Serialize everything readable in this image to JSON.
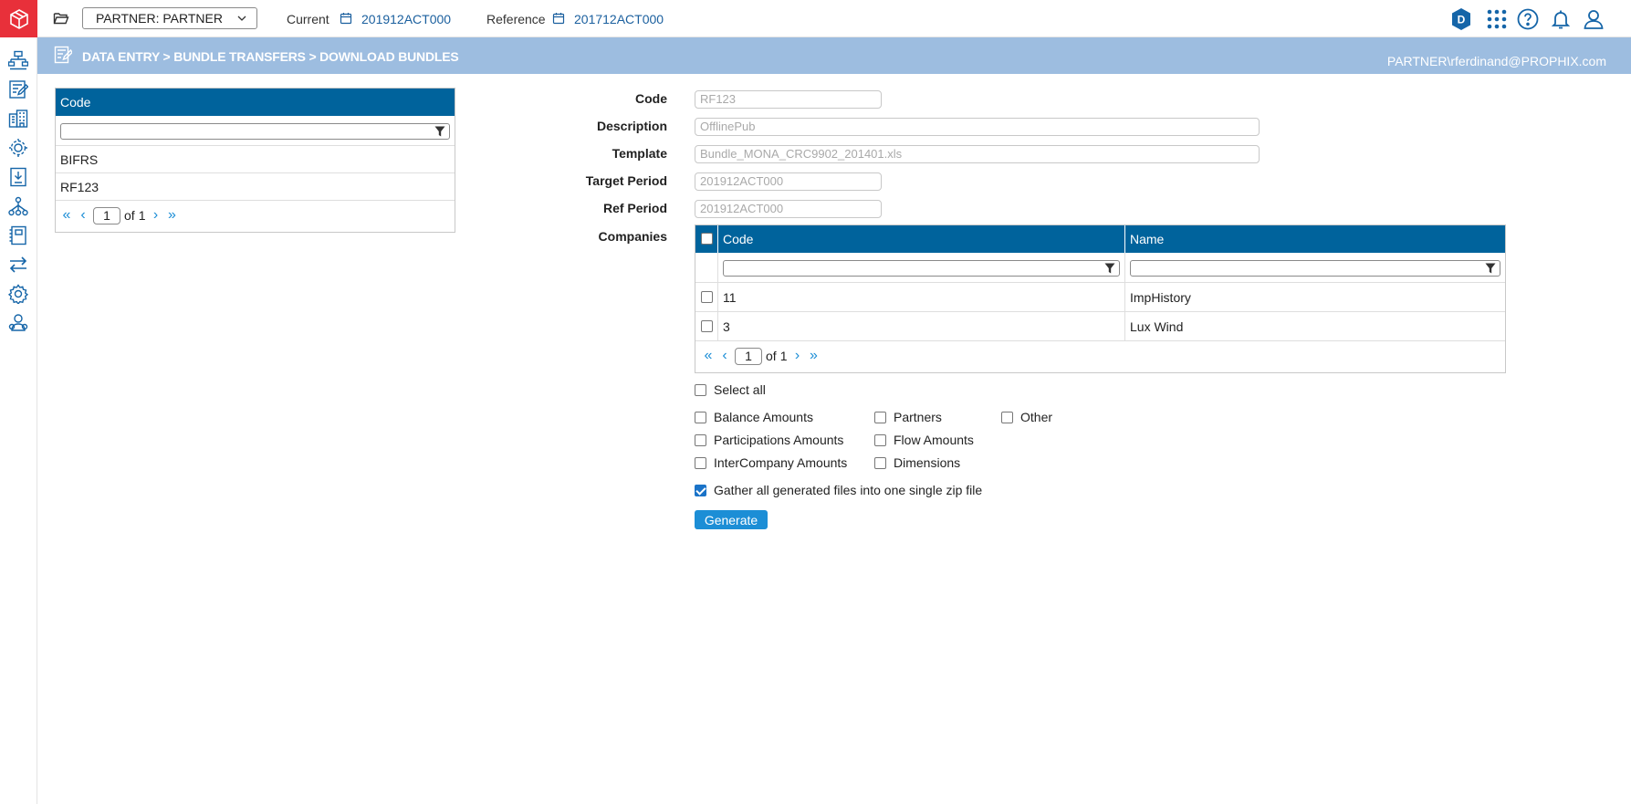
{
  "topbar": {
    "entity_select": "PARTNER: PARTNER",
    "current_label": "Current",
    "current_value": "201912ACT000",
    "reference_label": "Reference",
    "reference_value": "201712ACT000",
    "badge_letter": "D"
  },
  "header": {
    "breadcrumb": "DATA ENTRY > BUNDLE TRANSFERS > DOWNLOAD BUNDLES",
    "user": "PARTNER\\rferdinand@PROPHIX.com"
  },
  "left_grid": {
    "header": "Code",
    "rows": [
      "BIFRS",
      "RF123"
    ],
    "pager": {
      "page": "1",
      "of_label": "of",
      "total": "1"
    }
  },
  "form": {
    "code_label": "Code",
    "code_value": "RF123",
    "description_label": "Description",
    "description_value": "OfflinePub",
    "template_label": "Template",
    "template_value": "Bundle_MONA_CRC9902_201401.xls",
    "target_period_label": "Target Period",
    "target_period_value": "201912ACT000",
    "ref_period_label": "Ref Period",
    "ref_period_value": "201912ACT000",
    "companies_label": "Companies"
  },
  "companies": {
    "col_code": "Code",
    "col_name": "Name",
    "rows": [
      {
        "code": "11",
        "name": "ImpHistory"
      },
      {
        "code": "3",
        "name": "Lux Wind"
      }
    ],
    "pager": {
      "page": "1",
      "of_label": "of",
      "total": "1"
    }
  },
  "options": {
    "select_all": "Select all",
    "balance_amounts": "Balance Amounts",
    "partners": "Partners",
    "other": "Other",
    "participations_amounts": "Participations Amounts",
    "flow_amounts": "Flow Amounts",
    "intercompany_amounts": "InterCompany Amounts",
    "dimensions": "Dimensions",
    "gather_zip": "Gather all generated files into one single zip file",
    "gather_zip_checked": true
  },
  "generate_label": "Generate",
  "colors": {
    "grid_header": "#00639c",
    "header_band": "#9dbde0",
    "accent": "#1c8ed6",
    "logo": "#e8303a"
  }
}
